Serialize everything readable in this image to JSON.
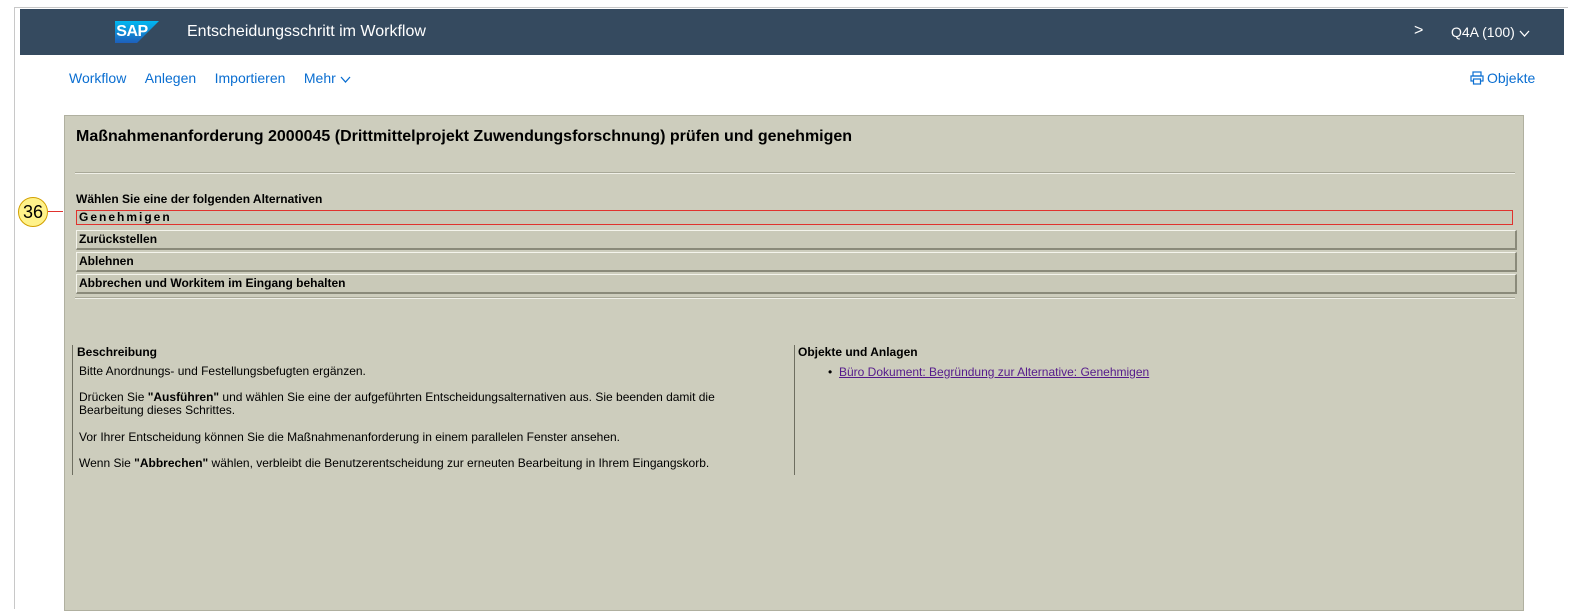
{
  "shell": {
    "logo": "SAP",
    "title": "Entscheidungsschritt im Workflow",
    "chevron": ">",
    "system": "Q4A (100)"
  },
  "toolbar": {
    "items": [
      "Workflow",
      "Anlegen",
      "Importieren",
      "Mehr"
    ],
    "objects_label": "Objekte"
  },
  "main": {
    "title": "Maßnahmenanforderung 2000045 (Drittmittelprojekt Zuwendungsforschnung) prüfen und genehmigen",
    "alternatives_label": "Wählen Sie eine der folgenden Alternativen",
    "alternatives": [
      "Genehmigen",
      "Zurückstellen",
      "Ablehnen",
      "Abbrechen und Workitem im Eingang behalten"
    ],
    "step_number": "36"
  },
  "description": {
    "heading": "Beschreibung",
    "line1": "Bitte Anordnungs- und Festellungsbefugten ergänzen.",
    "line2_a": "Drücken Sie ",
    "line2_b": "\"Ausführen\"",
    "line2_c": " und wählen Sie eine der aufgeführten Entscheidungsalternativen aus. Sie beenden damit die Bearbeitung dieses Schrittes.",
    "line3": "Vor Ihrer Entscheidung können Sie die Maßnahmenanforderung in einem parallelen Fenster ansehen.",
    "line4_a": "Wenn Sie ",
    "line4_b": "\"Abbrechen\"",
    "line4_c": " wählen, verbleibt die Benutzerentscheidung zur erneuten Bearbeitung in Ihrem Eingangskorb."
  },
  "objects": {
    "heading": "Objekte und Anlagen",
    "link": "Büro Dokument: Begründung zur Alternative: Genehmigen"
  },
  "colors": {
    "shell_bg": "#354a5f",
    "content_bg": "#cdcdbd",
    "link": "#0a6ed1",
    "highlight": "#e0322d",
    "badge": "#fff28a"
  }
}
